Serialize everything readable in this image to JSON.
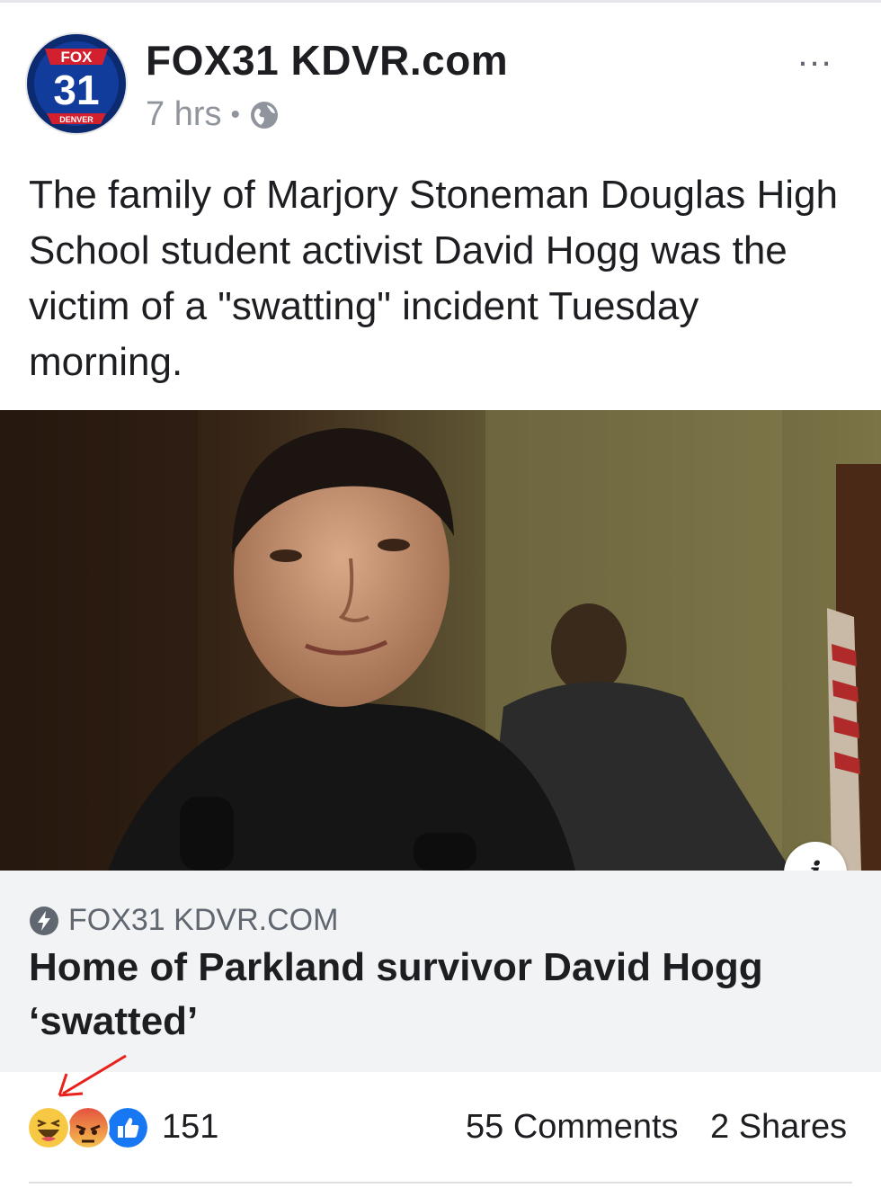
{
  "header": {
    "page_name": "FOX31 KDVR.com",
    "timestamp": "7 hrs",
    "separator": "•",
    "more_label": "...",
    "avatar": {
      "top_text": "FOX",
      "number": "31",
      "bottom_text": "DENVER"
    }
  },
  "post": {
    "text": "The family of Marjory Stoneman Douglas High School student activist David Hogg was the victim of a \"swatting\" incident Tuesday morning."
  },
  "media": {
    "info_label": "i"
  },
  "link": {
    "domain": "FOX31 KDVR.COM",
    "title": "Home of Parkland survivor David Hogg ‘swatted’"
  },
  "footer": {
    "reactions": [
      "haha-icon",
      "angry-icon",
      "like-icon"
    ],
    "reaction_count": "151",
    "comments": "55 Comments",
    "shares": "2 Shares"
  },
  "colors": {
    "annotation_arrow": "#e8221b",
    "like_blue": "#1877f2",
    "fox_blue": "#0b2a6f",
    "fox_red": "#d3202f"
  }
}
